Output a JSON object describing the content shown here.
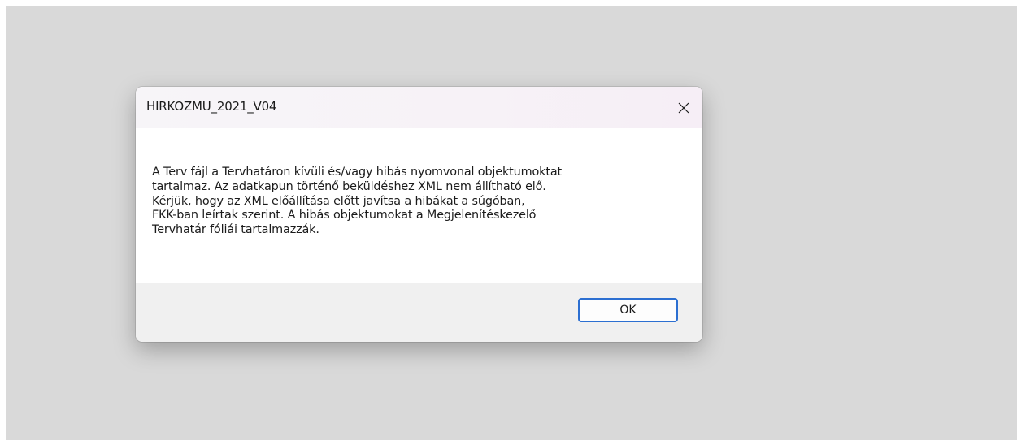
{
  "dialog": {
    "title": "HIRKOZMU_2021_V04",
    "close_icon": "close-icon",
    "message": "A Terv fájl a Tervhatáron kívüli és/vagy hibás nyomvonal objektumoktat\ntartalmaz. Az adatkapun történő beküldéshez XML nem állítható elő.\nKérjük, hogy az XML előállítása előtt javítsa a hibákat a súgóban,\nFKK-ban leírtak szerint. A hibás objektumokat a Megjelenítéskezelő\nTervhatár fóliái tartalmazzák.",
    "ok_label": "OK"
  },
  "colors": {
    "backdrop": "#d9d9d9",
    "footer": "#f0f0f0",
    "accent": "#2c6fd1"
  }
}
